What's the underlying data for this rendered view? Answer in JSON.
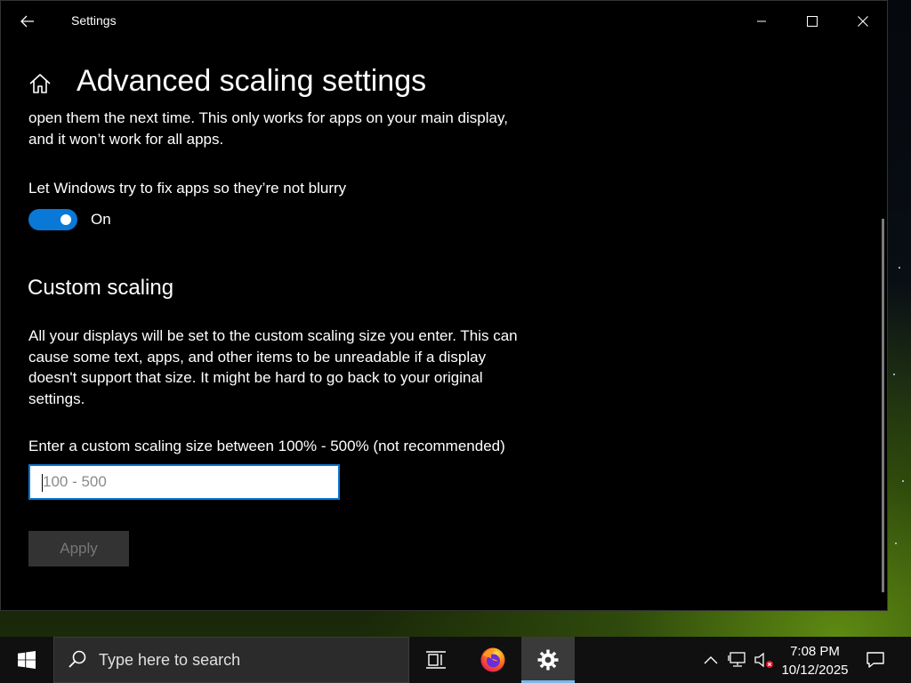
{
  "window": {
    "title": "Settings",
    "page_title": "Advanced scaling settings"
  },
  "content": {
    "intro_text": "open them the next time. This only works for apps on your main display, and it won’t work for all apps.",
    "fix_blurry_label": "Let Windows try to fix apps so they’re not blurry",
    "fix_blurry_state": "On",
    "custom_scaling_title": "Custom scaling",
    "custom_scaling_desc": "All your displays will be set to the custom scaling size you enter. This can cause some text, apps, and other items to be unreadable if a display doesn't support that size. It might be hard to go back to your original settings.",
    "custom_input_label": "Enter a custom scaling size between 100% - 500% (not recommended)",
    "custom_input_value": "",
    "custom_input_placeholder": "100 - 500",
    "apply_label": "Apply"
  },
  "taskbar": {
    "search_placeholder": "Type here to search",
    "time": "7:08 PM",
    "date": "10/12/2025"
  },
  "colors": {
    "accent": "#0a78d7",
    "window_bg": "#000000",
    "taskbar_bg": "#101010"
  },
  "icons": {
    "back": "arrow-left-icon",
    "home": "home-icon",
    "minimize": "minimize-icon",
    "maximize": "maximize-icon",
    "close": "close-icon",
    "start": "windows-logo-icon",
    "search": "search-icon",
    "task_view": "task-view-icon",
    "firefox": "firefox-icon",
    "settings": "gear-icon",
    "tray_chevron": "chevron-up-icon",
    "network": "network-icon",
    "volume": "volume-muted-icon",
    "notifications": "notification-icon"
  }
}
